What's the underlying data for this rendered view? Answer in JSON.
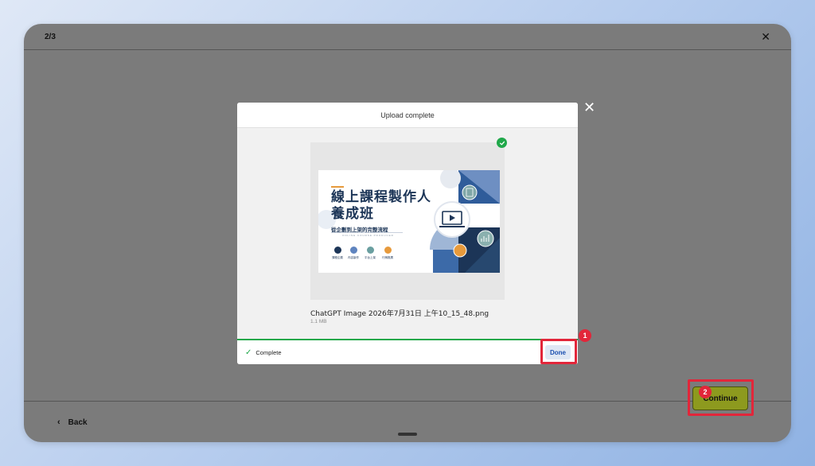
{
  "window": {
    "step": "2/3",
    "close_glyph": "✕",
    "back_label": "Back",
    "back_glyph": "‹",
    "continue_label": "Continue"
  },
  "modal": {
    "title": "Upload complete",
    "close_glyph": "✕",
    "file_name": "ChatGPT Image 2026年7月31日 上午10_15_48.png",
    "file_size": "1.1 MB",
    "status_label": "Complete",
    "done_label": "Done"
  },
  "thumbnail": {
    "title_line1": "線上課程製作人",
    "title_line2": "養成班",
    "subtitle": "從企劃到上架的完整流程",
    "english": "ONLINE COURSE PRODUCER",
    "icon_labels": [
      "課程企劃",
      "內容製作",
      "平台上架",
      "行銷推廣"
    ]
  },
  "annotations": {
    "badge1": "1",
    "badge2": "2"
  },
  "colors": {
    "accent_green": "#20a84a",
    "highlight_red": "#e2263a",
    "continue_olive": "#8d9a1e",
    "done_blue": "#1a4fb0",
    "poster_navy": "#1c3557"
  },
  "icons": [
    "close-icon",
    "back-arrow-icon",
    "check-circle-icon",
    "check-icon",
    "play-icon",
    "clipboard-icon",
    "chart-icon"
  ]
}
